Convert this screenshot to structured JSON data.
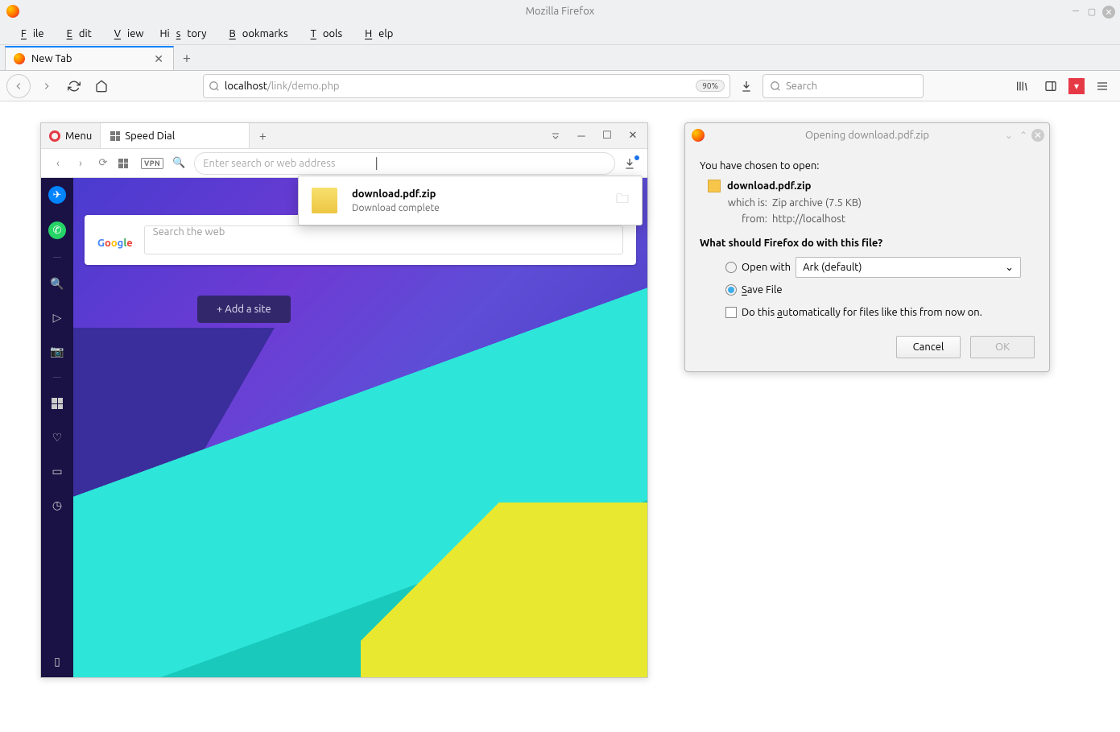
{
  "window": {
    "title": "Mozilla Firefox"
  },
  "menubar": [
    "File",
    "Edit",
    "View",
    "History",
    "Bookmarks",
    "Tools",
    "Help"
  ],
  "tab": {
    "label": "New Tab"
  },
  "url": {
    "prefix": "localhost",
    "suffix": "/link/demo.php",
    "zoom": "90%"
  },
  "search": {
    "placeholder": "Search"
  },
  "opera": {
    "menu": "Menu",
    "tab": "Speed Dial",
    "url_placeholder": "Enter search or web address",
    "search_placeholder": "Search the web",
    "addsite": "+  Add a site",
    "download": {
      "name": "download.pdf.zip",
      "status": "Download complete"
    }
  },
  "dialog": {
    "title": "Opening download.pdf.zip",
    "intro": "You have chosen to open:",
    "filename": "download.pdf.zip",
    "which_is_label": "which is:",
    "which_is": "Zip archive (7.5 KB)",
    "from_label": "from:",
    "from": "http://localhost",
    "question": "What should Firefox do with this file?",
    "open_with": "Open with",
    "open_app": "Ark (default)",
    "save_file": "Save File",
    "auto": "Do this automatically for files like this from now on.",
    "cancel": "Cancel",
    "ok": "OK"
  }
}
